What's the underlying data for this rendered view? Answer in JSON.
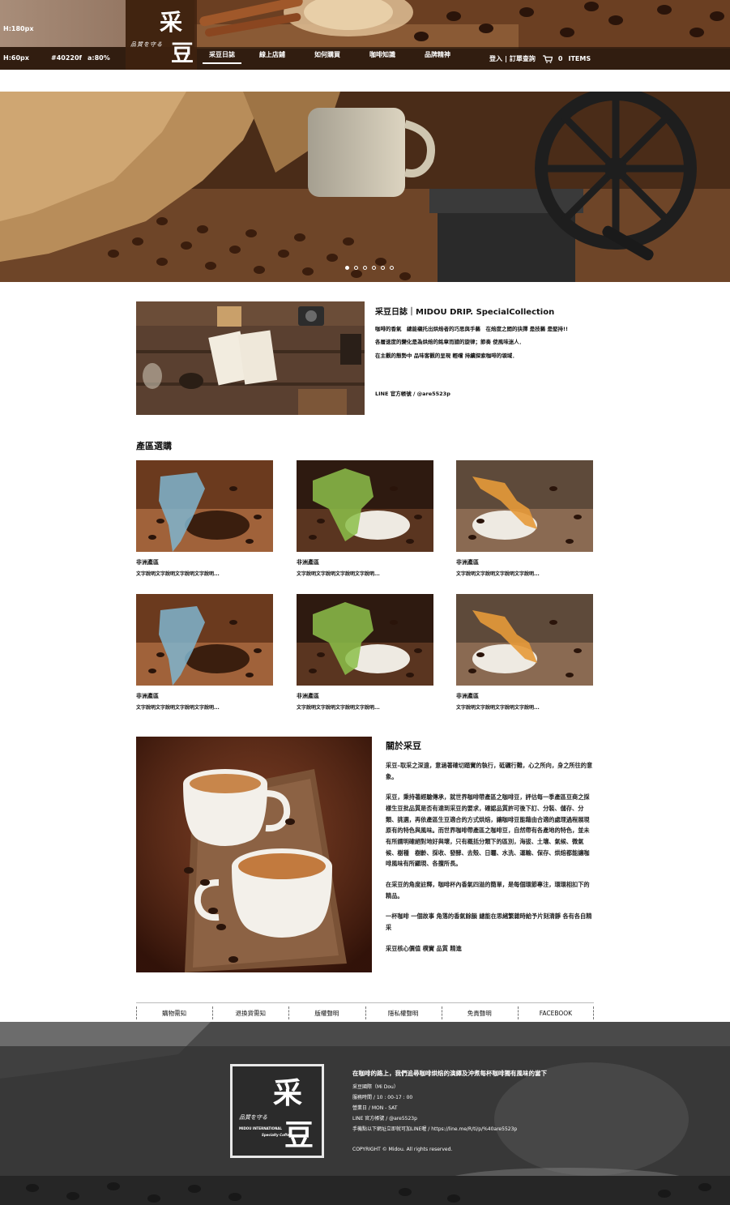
{
  "header": {
    "note_height": "H:180px",
    "note_bar": "H:60px",
    "note_color": "#40220f",
    "note_alpha": "a:80%",
    "logo_big_1": "采",
    "logo_big_2": "豆",
    "logo_small": "品質を守る",
    "nav": [
      "采豆日誌",
      "線上店鋪",
      "如何購買",
      "咖啡知識",
      "品牌精神"
    ],
    "login": "登入",
    "divider": "|",
    "orders": "訂單查詢",
    "cart_count": "0",
    "cart_label": "ITEMS"
  },
  "hero": {
    "slides": 6,
    "active_slide": 0
  },
  "intro": {
    "title": "采豆日誌｜MIDOU DRIP.  SpecialCollection",
    "p1": "咖啡的香氣　總能襯托出烘焙者的巧思與手藝　在焙度之間的抉擇  是技藝  是堅持!!",
    "p2": "各層速度的變化是為烘焙的銘章而譜的旋律；節奏  使風味迷人．",
    "p3": "在主觀的態勢中  品味客觀的呈現  輕嚐  持續探索咖啡的領域．",
    "line": "LINE 官方帳號 / @are5523p"
  },
  "regions": {
    "title": "產區選購",
    "items": [
      {
        "name": "非洲產區",
        "desc": "文字說明文字說明文字說明文字說明..."
      },
      {
        "name": "非洲產區",
        "desc": "文字說明文字說明文字說明文字說明..."
      },
      {
        "name": "非洲產區",
        "desc": "文字說明文字說明文字說明文字說明..."
      },
      {
        "name": "非洲產區",
        "desc": "文字說明文字說明文字說明文字說明..."
      },
      {
        "name": "非洲產區",
        "desc": "文字說明文字說明文字說明文字說明..."
      },
      {
        "name": "非洲產區",
        "desc": "文字說明文字說明文字說明文字說明..."
      }
    ]
  },
  "about": {
    "title": "關於采豆",
    "p1": "采豆–取采之深遠，意涵著確切踏實的執行，砥礪行難，心之所向，身之所往的意象。",
    "p2": "采豆，秉持著經驗傳承，就世界咖啡帶產區之咖啡豆，評估每一季產區豆商之採樣生豆批品質是否有達到采豆的要求，確認品質許可後下訂、分裝、儲存、分類、挑選，再依產區生豆適合的方式烘焙，讓咖啡豆能藉由合適的處理過程展現原有的特色與風味。而世界咖啡帶產區之咖啡豆，自然帶有各產地的特色，並未有所謂明確絕對地好與壞，只有概括分類下的區別，海拔、土壤、氣候、微氣候、樹種　樹齡、採收、發酵、去殼、日曬、水洗、運輸、保存、烘焙都能讓咖啡風味有所顯現、各擅所長。",
    "p3": "在采豆的角度註釋，咖啡杯內香氣四溢的簡單，是每個環節專注，環環相扣下的精品。",
    "p4": "一杯咖啡 一個故事 角落的香氣餘韻 總能在思緒繁雜時給予片刻清靜 各有各自精采",
    "p5": "采豆核心價值 樸實 品質 精進"
  },
  "footer_links": [
    "購物需知",
    "退換貨需知",
    "版權聲明",
    "隱私權聲明",
    "免責聲明",
    "FACEBOOK"
  ],
  "footer": {
    "logo_big_1": "采",
    "logo_big_2": "豆",
    "logo_small": "品質を守る",
    "logo_sub1": "MIDOU INTERNATIONAL",
    "logo_sub2": "Specialty Coffee",
    "headline": "在咖啡的路上，我們追尋咖啡烘焙的演繹及沖煮每杯咖啡獨有風味的當下",
    "company": "采豆國際（Mi Dou）",
    "hours": "服務時間 / 10 : 00-17 : 00",
    "days": "營業日 / MON - SAT",
    "line": "LINE 官方帳號 / @are5523p",
    "line_link": "手機點以下網址立即就可加LINE喔 /  https://line.me/R/ti/p/%40are5523p",
    "copyright": "COPYRIGHT  © Midou. All rights reserved."
  }
}
